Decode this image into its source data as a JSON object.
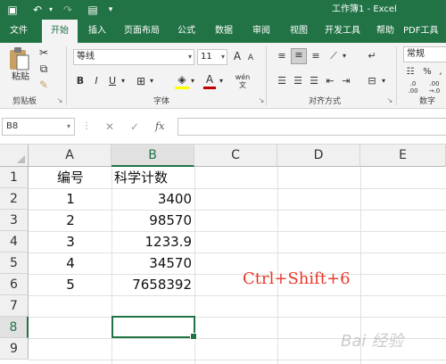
{
  "titlebar": {
    "title": "工作簿1  -  Excel",
    "accent": "#217346"
  },
  "tabs": [
    "文件",
    "开始",
    "插入",
    "页面布局",
    "公式",
    "数据",
    "审阅",
    "视图",
    "开发工具",
    "帮助",
    "PDF工具"
  ],
  "active_tab": "开始",
  "ribbon": {
    "clipboard": {
      "paste_label": "粘贴",
      "group_label": "剪贴板"
    },
    "font": {
      "font_name": "等线",
      "font_size": "11",
      "bold": "B",
      "italic": "I",
      "underline": "U",
      "grow": "A",
      "shrink": "A",
      "wen": "wén",
      "group_label": "字体",
      "font_color": "#c00000"
    },
    "alignment": {
      "group_label": "对齐方式"
    },
    "number": {
      "format": "常规",
      "group_label": "数字"
    }
  },
  "formula_bar": {
    "name_box": "B8",
    "cancel": "✕",
    "enter": "✓",
    "fx": "fx",
    "value": ""
  },
  "sheet": {
    "columns": [
      "A",
      "B",
      "C",
      "D",
      "E"
    ],
    "selected_column": "B",
    "rows": [
      "1",
      "2",
      "3",
      "4",
      "5",
      "6",
      "7",
      "8",
      "9"
    ],
    "selected_row": "8",
    "cells": {
      "A1": "编号",
      "B1": "科学计数",
      "A2": "1",
      "B2": "3400",
      "A3": "2",
      "B3": "98570",
      "A4": "3",
      "B4": "1233.9",
      "A5": "4",
      "B5": "34570",
      "A6": "5",
      "B6": "7658392"
    },
    "note": "Ctrl+Shift+6",
    "note_color": "#e8382a"
  },
  "watermark": "Bai 经验"
}
